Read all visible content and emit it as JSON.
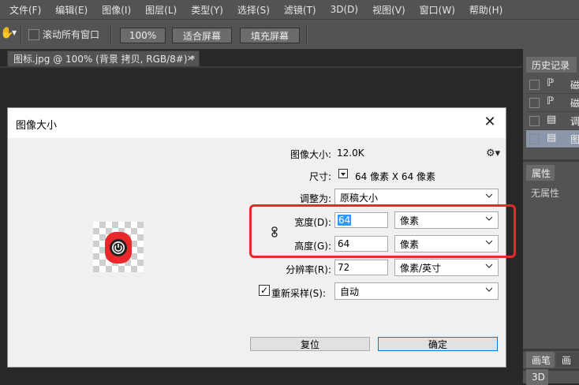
{
  "menu": [
    "文件(F)",
    "编辑(E)",
    "图像(I)",
    "图层(L)",
    "类型(Y)",
    "选择(S)",
    "滤镜(T)",
    "3D(D)",
    "视图(V)",
    "窗口(W)",
    "帮助(H)"
  ],
  "options_bar": {
    "scroll_all_windows": "滚动所有窗口",
    "btn_100": "100%",
    "btn_fit": "适合屏幕",
    "btn_fill": "填充屏幕"
  },
  "doc_tab": {
    "title": "图标.jpg @ 100% (背景 拷贝, RGB/8#) *",
    "close": "×"
  },
  "right_panel": {
    "history_tab": "历史记录",
    "history_items": [
      "磁",
      "磁",
      "调",
      "图"
    ],
    "properties_tab": "属性",
    "properties_empty": "无属性",
    "bottom_tabs": [
      "画笔",
      "画"
    ],
    "bottom_tab_3d": "3D"
  },
  "dialog": {
    "title": "图像大小",
    "close": "✕",
    "image_size_label": "图像大小:",
    "image_size_value": "12.0K",
    "dimensions_label": "尺寸:",
    "dimensions_value": "64 像素  X  64 像素",
    "fit_to_label": "调整为:",
    "fit_to_value": "原稿大小",
    "width_label": "宽度(D):",
    "width_value": "64",
    "width_unit": "像素",
    "height_label": "高度(G):",
    "height_value": "64",
    "height_unit": "像素",
    "resolution_label": "分辨率(R):",
    "resolution_value": "72",
    "resolution_unit": "像素/英寸",
    "resample_label": "重新采样(S):",
    "resample_value": "自动",
    "resample_checked": "✓",
    "reset_button": "复位",
    "ok_button": "确定"
  },
  "colors": {
    "highlight": "#e8282a",
    "accent": "#0078d7",
    "selection": "#3399ff"
  }
}
